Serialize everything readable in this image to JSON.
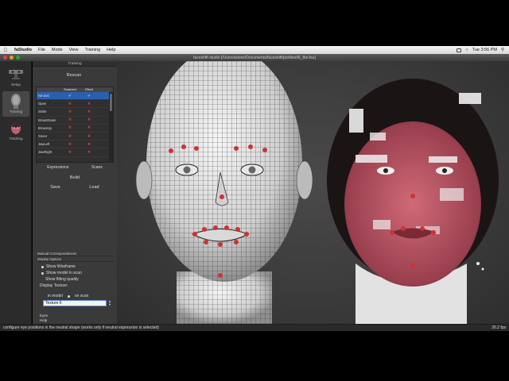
{
  "menubar": {
    "app_name": "faStudio",
    "items": [
      "File",
      "Mode",
      "View",
      "Training",
      "Help"
    ],
    "clock": "Tue 3:56 PM"
  },
  "window": {
    "title": "faceshift studio [/Users/weise/Documents/faceshift/profiles/t6_tbo.fsu]"
  },
  "toolstrip": {
    "tools": [
      {
        "label": "Setup",
        "icon": "camera-sensor-icon"
      },
      {
        "label": "Training",
        "icon": "head-profile-icon"
      },
      {
        "label": "Tracking",
        "icon": "face-tracking-icon"
      }
    ]
  },
  "panel": {
    "header": "Training",
    "rescan_label": "Rescan",
    "table": {
      "columns": [
        "",
        "Scanned",
        "Fitted"
      ],
      "rows": [
        {
          "name": "Neutral",
          "scanned": true,
          "fitted": true,
          "selected": true
        },
        {
          "name": "Open",
          "scanned": false,
          "fitted": false
        },
        {
          "name": "Smile",
          "scanned": false,
          "fitted": false
        },
        {
          "name": "BrowsDown",
          "scanned": false,
          "fitted": false
        },
        {
          "name": "BrowsUp",
          "scanned": false,
          "fitted": false
        },
        {
          "name": "Sneer",
          "scanned": false,
          "fitted": false
        },
        {
          "name": "JawLeft",
          "scanned": false,
          "fitted": false
        },
        {
          "name": "JawRight",
          "scanned": false,
          "fitted": false
        }
      ]
    },
    "tab_expressions": "Expressions",
    "tab_scans": "Scans",
    "build_label": "Build",
    "save_label": "Save",
    "load_label": "Load",
    "manual_correspondences": "Manual Correspondences",
    "display_options": "Display Options",
    "opt_wireframe": "Show Wireframe",
    "opt_model_in_scan": "Show model in scan",
    "opt_fitting_quality": "Show fitting quality",
    "display_texture_label": "Display Texture:",
    "radio_in_model": "in model",
    "radio_on_scan": "on scan",
    "texture_value": "Texture 6",
    "eyes_label": "Eyes",
    "help_label": "Help"
  },
  "status": {
    "message": "configure eye positions in the neutral shape (works only if neutral expression is selected)",
    "fps": "26.2 fps"
  },
  "colors": {
    "selection": "#2a5fb0",
    "marker": "#c33333",
    "viewport_bg": "#3a3a3a"
  }
}
